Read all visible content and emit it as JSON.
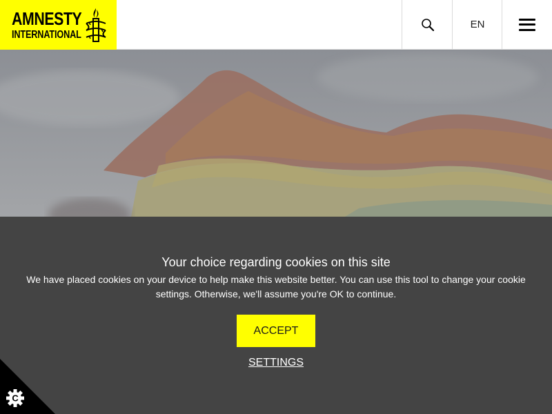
{
  "header": {
    "logo": {
      "line1": "AMNESTY",
      "line2": "INTERNATIONAL",
      "background": "#ffff00"
    },
    "search_icon": "search-icon",
    "language": "EN",
    "menu_icon": "hamburger-menu-icon"
  },
  "hero": {
    "image": "rainbow-pride-flag-photo"
  },
  "cookie_banner": {
    "title": "Your choice regarding cookies on this site",
    "description": "We have placed cookies on your device to help make this website better. You can use this tool to change your cookie settings. Otherwise, we'll assume you're OK to continue.",
    "accept_label": "ACCEPT",
    "settings_label": "SETTINGS",
    "background": "#444444",
    "accent": "#ffff00",
    "corner_icon": "cookie-settings-icon"
  }
}
